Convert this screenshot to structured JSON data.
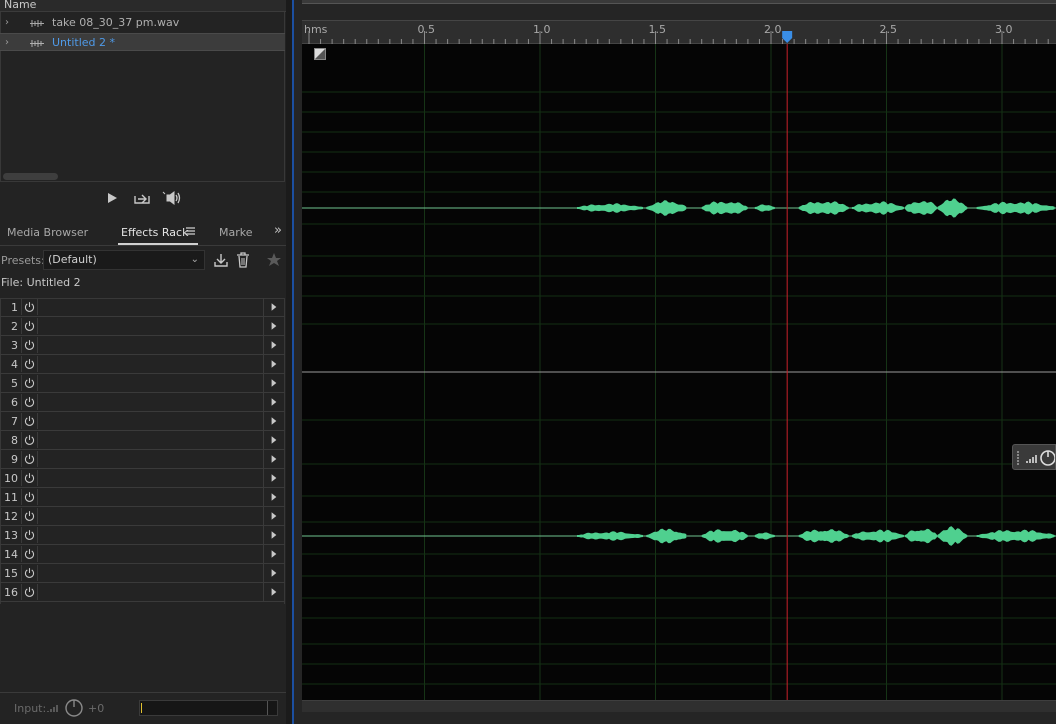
{
  "files": {
    "header": "Name",
    "items": [
      {
        "name": "take 08_30_37 pm.wav",
        "selected": false
      },
      {
        "name": "Untitled 2 *",
        "selected": true
      }
    ],
    "controls": [
      "play-icon",
      "export-icon",
      "speaker-icon"
    ]
  },
  "effects_rack": {
    "tabs": [
      "Media Browser",
      "Effects Rack",
      "Marke"
    ],
    "active_tab": "Effects Rack",
    "more_label": "»",
    "presets_label": "Presets:",
    "preset_value": "(Default)",
    "file_label": "File: Untitled 2",
    "slots": [
      "1",
      "2",
      "3",
      "4",
      "5",
      "6",
      "7",
      "8",
      "9",
      "10",
      "11",
      "12",
      "13",
      "14",
      "15",
      "16"
    ],
    "input_label": "Input:",
    "input_value": "+0"
  },
  "editor": {
    "ruler_unit": "hms",
    "ruler_ticks": [
      "0.5",
      "1.0",
      "1.5",
      "2.0",
      "2.5",
      "3.0"
    ],
    "playhead_time": 2.07,
    "waveform_color": "#4fd08f",
    "playhead_color": "#c8202a",
    "selection_color": "#1c4fa0"
  }
}
